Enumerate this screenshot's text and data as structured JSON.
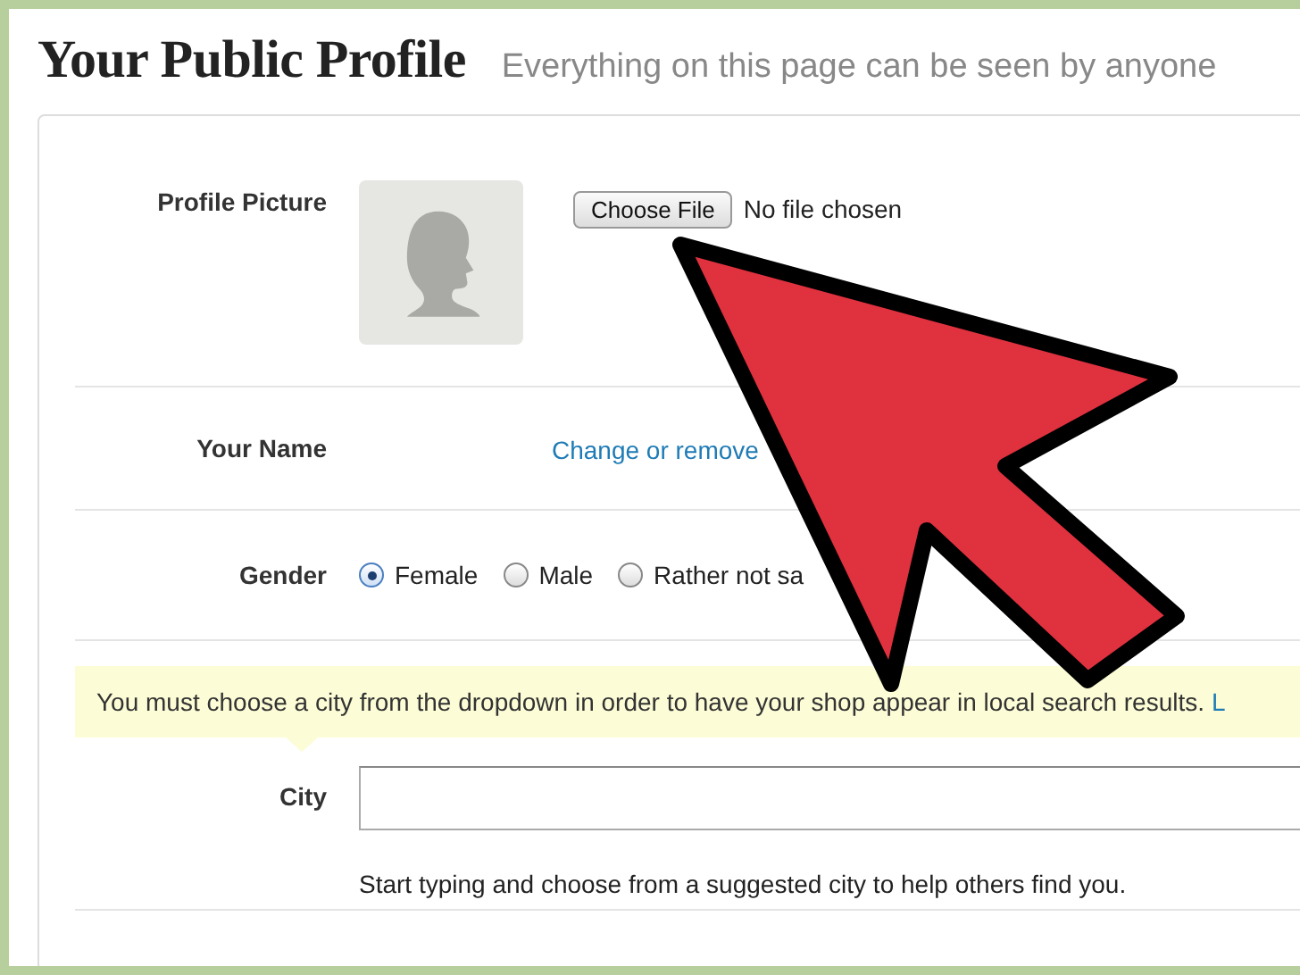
{
  "page": {
    "title": "Your Public Profile",
    "subtitle": "Everything on this page can be seen by anyone"
  },
  "profile_picture": {
    "label": "Profile Picture",
    "button": "Choose File",
    "file_status": "No file chosen"
  },
  "name": {
    "label": "Your Name",
    "link": "Change or remove"
  },
  "gender": {
    "label": "Gender",
    "options": [
      {
        "label": "Female",
        "selected": true
      },
      {
        "label": "Male",
        "selected": false
      },
      {
        "label": "Rather not sa",
        "selected": false
      }
    ]
  },
  "notice": {
    "text": "You must choose a city from the dropdown in order to have your shop appear in local search results.",
    "link": "L"
  },
  "city": {
    "label": "City",
    "hint": "Start typing and choose from a suggested city to help others find you."
  }
}
